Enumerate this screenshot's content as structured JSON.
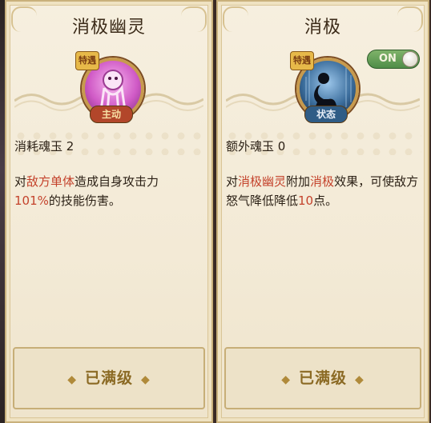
{
  "left_card": {
    "title": "消极幽灵",
    "icon_name": "pink-ghost-skill-icon",
    "tag_top": "特遇",
    "tag_bottom": "主动",
    "cost_text": "消耗魂玉 2",
    "desc_parts": [
      "对",
      "敌方单体",
      "造成自身攻击力",
      "101%",
      "的技能伤害。"
    ],
    "level_text": "已满级"
  },
  "right_card": {
    "title": "消极",
    "icon_name": "slumped-figure-skill-icon",
    "tag_top": "特遇",
    "tag_bottom": "状态",
    "toggle_label": "ON",
    "toggle_state": "on",
    "cost_text": "额外魂玉 0",
    "desc_parts": [
      "对",
      "消极幽灵",
      "附加",
      "消极",
      "效果，可使敌方怒气降低降低",
      "10",
      "点。"
    ],
    "level_text": "已满级"
  },
  "colors": {
    "highlight": "#c4422b",
    "text": "#2a1f14",
    "active_tag": "#b2462a",
    "passive_tag": "#2f5c86",
    "toggle_on": "#5f9d52"
  }
}
